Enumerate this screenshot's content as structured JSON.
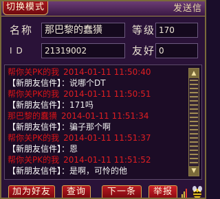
{
  "titlebar": {
    "mode_tab": "切换模式",
    "send_info": "发送信"
  },
  "info": {
    "name_label": "名称",
    "name_value": "那巴黎的蠢獚",
    "level_label": "等级",
    "level_value": "170",
    "id_label": "ID",
    "id_value": "21319002",
    "friend_label": "友好",
    "friend_value": "0"
  },
  "chat": {
    "messages": [
      {
        "sender": "帮你关PK的我",
        "time": "2014-01-11 11:50:40",
        "source": "【新朋友信件】",
        "text": "：说哪个DT"
      },
      {
        "sender": "帮你关PK的我",
        "time": "2014-01-11 11:50:51",
        "source": "【新朋友信件】",
        "text": "：171吗"
      },
      {
        "sender": "那巴黎的蠢獚",
        "time": "2014-01-11 11:51:34",
        "source": "【新朋友信件】",
        "text": "：骗子那个啊"
      },
      {
        "sender": "帮你关PK的我",
        "time": "2014-01-11 11:51:37",
        "source": "【新朋友信件】",
        "text": "：恩"
      },
      {
        "sender": "帮你关PK的我",
        "time": "2014-01-11 11:51:52",
        "source": "【新朋友信件】",
        "text": "：是啊，可怜的他"
      }
    ]
  },
  "buttons": {
    "add_friend": "加为好友",
    "query": "查询",
    "next": "下一条",
    "report": "举报"
  },
  "colors": {
    "sender": "#d81418",
    "button": "#b81a22",
    "frame": "#7a6a3a"
  }
}
